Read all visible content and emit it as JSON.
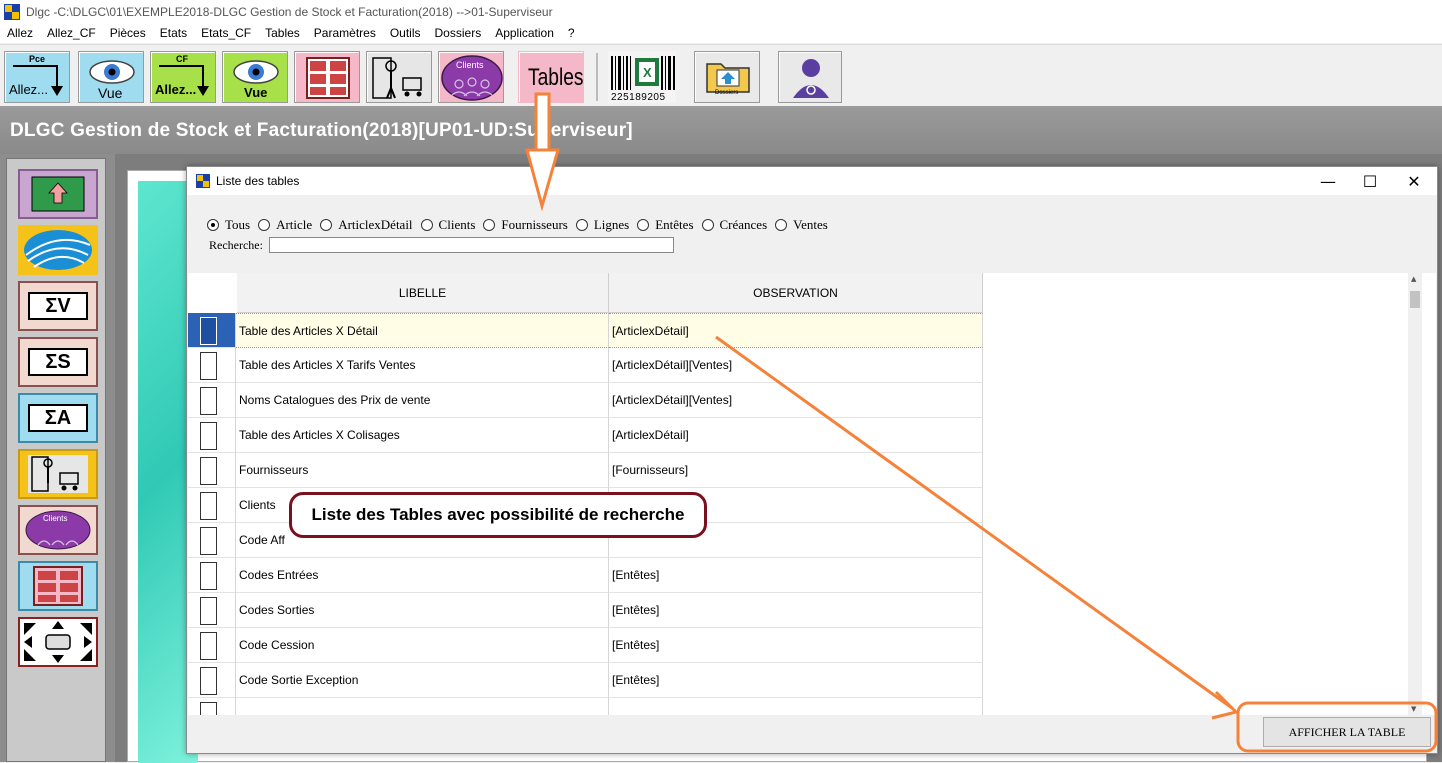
{
  "window": {
    "title": "Dlgc -C:\\DLGC\\01\\EXEMPLE2018-DLGC Gestion de Stock et Facturation(2018) -->01-Superviseur"
  },
  "menu": [
    "Allez",
    "Allez_CF",
    "Pièces",
    "Etats",
    "Etats_CF",
    "Tables",
    "Paramètres",
    "Outils",
    "Dossiers",
    "Application",
    "?"
  ],
  "toolbar": {
    "allez_pce_top": "Pce",
    "allez_pce_label": "Allez...",
    "vue1_label": "Vue",
    "allez_cf_top": "CF",
    "allez_cf_label": "Allez...",
    "vue2_label": "Vue",
    "clients_label": "Clients",
    "tables_label": "Tables",
    "barcode_number": "225189205",
    "dossiers_label": "Dossiers"
  },
  "header": {
    "title": "DLGC Gestion de Stock et Facturation(2018)[UP01-UD:Superviseur]"
  },
  "sidebar": {
    "sigma_v": "ΣV",
    "sigma_s": "ΣS",
    "sigma_a": "ΣA",
    "clients_label": "Clients"
  },
  "dialog": {
    "title": "Liste des tables",
    "filters": [
      "Tous",
      "Article",
      "ArticlexDétail",
      "Clients",
      "Fournisseurs",
      "Lignes",
      "Entêtes",
      "Créances",
      "Ventes"
    ],
    "selected_filter": "Tous",
    "search_label": "Recherche:",
    "search_value": "",
    "columns": [
      "LIBELLE",
      "OBSERVATION"
    ],
    "rows": [
      {
        "libelle": "Table des Articles X Détail",
        "observation": "[ArticlexDétail]"
      },
      {
        "libelle": "Table des Articles X Tarifs Ventes",
        "observation": "[ArticlexDétail][Ventes]"
      },
      {
        "libelle": "Noms Catalogues des Prix de vente",
        "observation": "[ArticlexDétail][Ventes]"
      },
      {
        "libelle": "Table des Articles X Colisages",
        "observation": "[ArticlexDétail]"
      },
      {
        "libelle": "Fournisseurs",
        "observation": "[Fournisseurs]"
      },
      {
        "libelle": "Clients",
        "observation": ""
      },
      {
        "libelle": "Code Aff",
        "observation": ""
      },
      {
        "libelle": "Codes Entrées",
        "observation": "[Entêtes]"
      },
      {
        "libelle": "Codes Sorties",
        "observation": "[Entêtes]"
      },
      {
        "libelle": "Code Cession",
        "observation": "[Entêtes]"
      },
      {
        "libelle": "Code Sortie Exception",
        "observation": "[Entêtes]"
      },
      {
        "libelle": "",
        "observation": ""
      }
    ],
    "action_button": "AFFICHER LA TABLE"
  },
  "annotation": {
    "text": "Liste des Tables avec possibilité de recherche"
  },
  "colors": {
    "header_bg": "#8f8f8f",
    "selection": "#2b62b5",
    "annotation_border": "#7a0f1e",
    "arrow": "#f5823a"
  }
}
